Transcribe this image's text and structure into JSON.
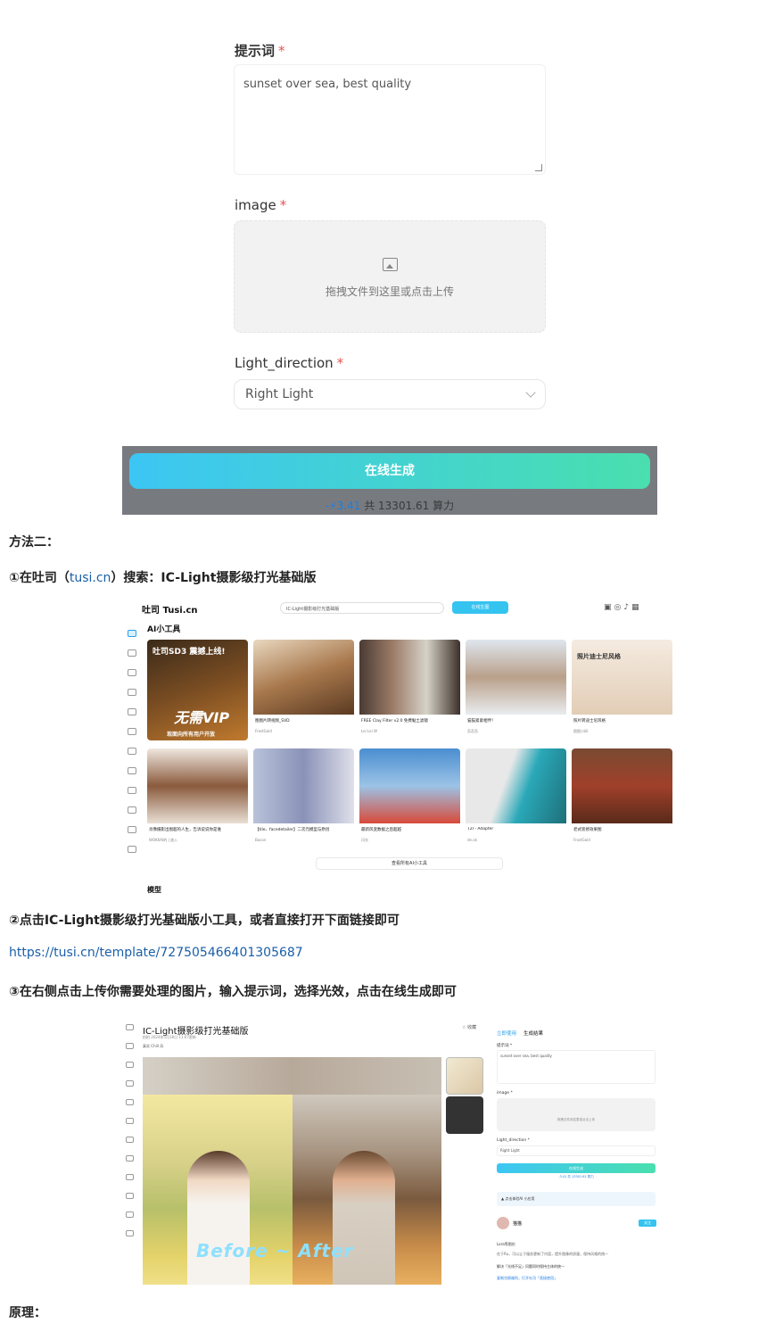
{
  "form": {
    "prompt_label": "提示词",
    "required_mark": "*",
    "prompt_value": "sunset over sea, best quality",
    "image_label": "image",
    "upload_hint": "拖拽文件到这里或点击上传",
    "light_label": "Light_direction",
    "light_value": "Right Light",
    "generate_label": "在线生成",
    "cost_prefix": "-",
    "cost_value": "3.41",
    "cost_total": "共 13301.61 算力"
  },
  "article": {
    "method2": "方法二：",
    "step1_prefix": "①在吐司（",
    "step1_link": "tusi.cn",
    "step1_suffix": "）搜索：IC-Light摄影级打光基础版",
    "step2": "②点击IC-Light摄影级打光基础版小工具，或者直接打开下面链接即可",
    "url": "https://tusi.cn/template/727505466401305687",
    "step3": "③在右侧点击上传你需要处理的图片，输入提示词，选择光效，点击在线生成即可",
    "principle": "原理："
  },
  "gallery": {
    "logo": "吐司 Tusi.cn",
    "search_value": "IC-Light摄影级打光基础版",
    "online_button": "在线生图",
    "heading": "AI小工具",
    "more_label": "查看所有AI小工具",
    "model_label": "模型",
    "cards": [
      {
        "caption": "吐司SD3 震撼上线!",
        "overlay": "吐司SD3 震撼上线!",
        "vip": "无需VIP",
        "vip_sub": "现面向所有用户开放"
      },
      {
        "caption": "图图片转视频_SVD",
        "meta": "FrostGold"
      },
      {
        "caption": "FREE Clay Filter v2.0 免费黏土滤镜",
        "meta": "Lei Lei W"
      },
      {
        "caption": "猫猫紧紧相伴！",
        "meta": "吾吾吾"
      },
      {
        "caption": "照片转迪士尼风格",
        "overlay": "照片迪士尼风格",
        "meta": "图图小研"
      },
      {
        "caption": "肖像摄影出图超的人生，告诉说说你是谁",
        "meta": "WOKKAI的 | 放入"
      },
      {
        "caption": "【tile、facedetailer】二次元模型与原创",
        "meta": "Bacon"
      },
      {
        "caption": "最新风变数据之后超越",
        "meta": "闪光"
      },
      {
        "caption": "T2I - Adapter",
        "meta": "de.ok"
      },
      {
        "caption": "老式装修效果图",
        "meta": "FrostGold"
      }
    ]
  },
  "template": {
    "title": "IC-Light摄影级打光基础版",
    "sub": "拍拍  2024年5月18日 11:07更新",
    "tags": "真实  Chill 风",
    "fav": "☆ 收藏",
    "tab_use": "立即使用",
    "tab_result": "生成结果",
    "prompt_label": "提示词 *",
    "prompt_value": "sunset over sea, best quality",
    "image_label": "image *",
    "upload_hint": "拖拽文件到这里或点击上传",
    "light_label": "Light_direction *",
    "light_value": "Right Light",
    "generate_label": "在线生成",
    "cost": "-3.41 共 13301.61 算力",
    "promo": "▲ 点击体验AI 小应用",
    "user_name": "猫猫",
    "follow": "关注",
    "detail1": "Lora等图仿",
    "detail2": "在于Ru，可以让于服务更新了内容，提升图像的质量，保持风格的统一",
    "detail3": "解决「光线不足」问题同时保持主体的统一",
    "detail4": "复制兑换福利，打开吐司「直接使用」",
    "before_after": "Before ~ After"
  },
  "colors": {
    "accent": "#3cc6f4",
    "accent_end": "#4adfae",
    "link": "#1a5fa8",
    "required": "#e55353"
  }
}
